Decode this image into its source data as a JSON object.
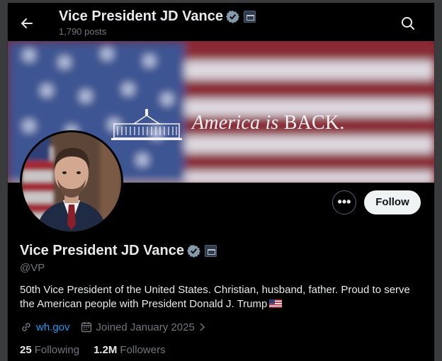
{
  "header": {
    "title": "Vice President JD Vance",
    "posts": "1,790 posts"
  },
  "banner": {
    "text_italic": "America is ",
    "text_caps": "BACK."
  },
  "actions": {
    "more": "•••",
    "follow": "Follow"
  },
  "profile": {
    "name": "Vice President JD Vance",
    "handle": "@VP",
    "bio": "50th Vice President of the United States. Christian, husband, father. Proud to serve the American people with President Donald J. Trump",
    "website": "wh.gov",
    "joined": "Joined January 2025"
  },
  "stats": {
    "following_count": "25",
    "following_label": "Following",
    "followers_count": "1.2M",
    "followers_label": "Followers"
  },
  "colors": {
    "background": "#000000",
    "text": "#e7e9ea",
    "muted": "#71767b",
    "link": "#1d9bf0",
    "verified": "#829aab"
  },
  "icons": [
    "back-arrow-icon",
    "search-icon",
    "verified-badge-icon",
    "government-affiliation-icon",
    "more-icon",
    "link-icon",
    "calendar-icon",
    "chevron-right-icon",
    "us-flag-icon"
  ]
}
